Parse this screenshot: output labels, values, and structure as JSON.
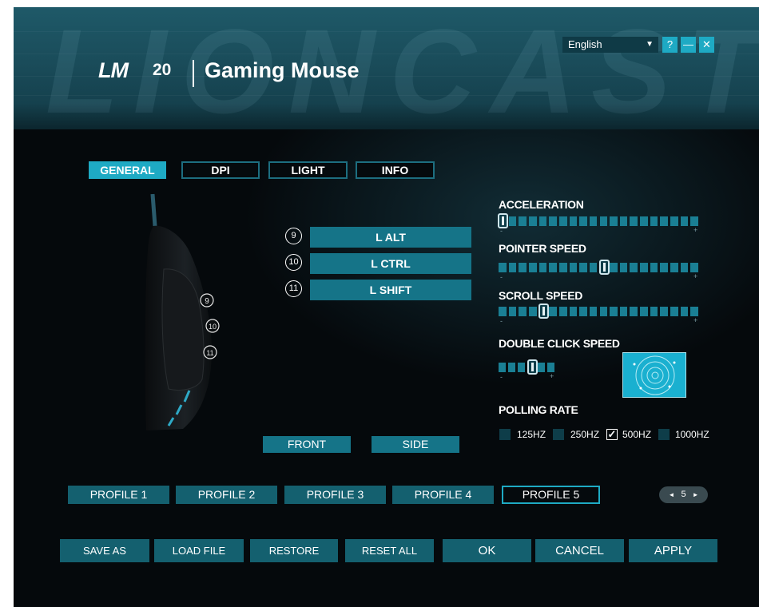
{
  "header": {
    "watermark": "LIONCAST",
    "logo": "LM",
    "model": "20",
    "title": "Gaming Mouse",
    "language": "English",
    "help_label": "?",
    "minimize_label": "—",
    "close_label": "✕"
  },
  "tabs": [
    {
      "label": "GENERAL",
      "active": true
    },
    {
      "label": "DPI",
      "active": false
    },
    {
      "label": "LIGHT",
      "active": false
    },
    {
      "label": "INFO",
      "active": false
    }
  ],
  "mouse_buttons": [
    {
      "number": "9",
      "mapping": "L ALT"
    },
    {
      "number": "10",
      "mapping": "L CTRL"
    },
    {
      "number": "11",
      "mapping": "L SHIFT"
    }
  ],
  "views": {
    "front": "FRONT",
    "side": "SIDE"
  },
  "settings": {
    "acceleration": {
      "label": "ACCELERATION",
      "level": 0,
      "steps": 20,
      "minus": "-",
      "plus": "+"
    },
    "pointer_speed": {
      "label": "POINTER SPEED",
      "level": 10,
      "steps": 20,
      "minus": "-",
      "plus": "+"
    },
    "scroll_speed": {
      "label": "SCROLL SPEED",
      "level": 4,
      "steps": 20,
      "minus": "-",
      "plus": "+"
    },
    "double_click_speed": {
      "label": "DOUBLE CLICK SPEED",
      "level": 3,
      "steps": 6,
      "minus": "-",
      "plus": "+"
    },
    "polling_rate": {
      "label": "POLLING RATE",
      "options": [
        "125HZ",
        "250HZ",
        "500HZ",
        "1000HZ"
      ],
      "selected": "500HZ",
      "check_mark": "✓"
    }
  },
  "profiles": {
    "items": [
      "PROFILE 1",
      "PROFILE 2",
      "PROFILE 3",
      "PROFILE 4",
      "PROFILE 5"
    ],
    "active": "PROFILE 5",
    "pager": {
      "prev": "◄",
      "value": "5",
      "next": "►"
    }
  },
  "actions": {
    "save_as": "SAVE AS",
    "load_file": "LOAD FILE",
    "restore": "RESTORE",
    "reset_all": "RESET ALL",
    "ok": "OK",
    "cancel": "CANCEL",
    "apply": "APPLY"
  },
  "colors": {
    "accent": "#1eaac4",
    "button": "#157488",
    "background": "#05090c"
  }
}
